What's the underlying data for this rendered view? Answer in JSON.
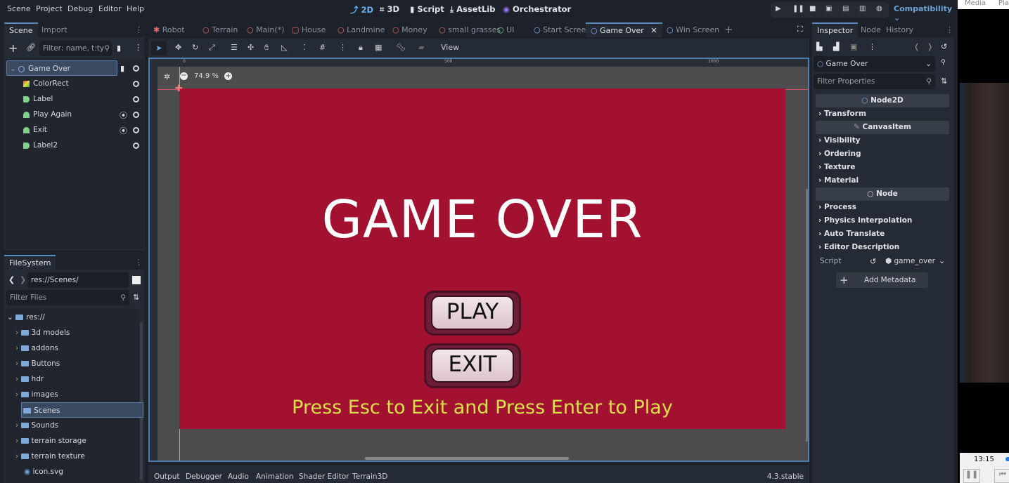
{
  "menu": [
    "Scene",
    "Project",
    "Debug",
    "Editor",
    "Help"
  ],
  "main_screens": [
    "2D",
    "3D",
    "Script",
    "AssetLib",
    "Orchestrator"
  ],
  "renderer": "Compatibility",
  "scene_dock": {
    "tabs": [
      "Scene",
      "Import"
    ],
    "filter_placeholder": "Filter: name, t:ty",
    "nodes": [
      {
        "name": "Game Over",
        "type": "Node2D"
      },
      {
        "name": "ColorRect",
        "type": "ColorRect"
      },
      {
        "name": "Label",
        "type": "Label"
      },
      {
        "name": "Play Again",
        "type": "Button"
      },
      {
        "name": "Exit",
        "type": "Button"
      },
      {
        "name": "Label2",
        "type": "Label"
      }
    ]
  },
  "filesystem": {
    "tab": "FileSystem",
    "path": "res://Scenes/",
    "filter_placeholder": "Filter Files",
    "items": [
      "res://",
      "3d models",
      "addons",
      "Buttons",
      "hdr",
      "images",
      "Scenes",
      "Sounds",
      "terrain storage",
      "terrain texture",
      "icon.svg"
    ]
  },
  "scene_tabs": [
    "Robot",
    "Terrain",
    "Main(*)",
    "House",
    "Landmine",
    "Money",
    "small grasses",
    "UI",
    "Start  Screen",
    "Game Over",
    "Win Screen"
  ],
  "toolbar": {
    "view": "View"
  },
  "viewport": {
    "zoom": "74.9 %",
    "ruler": [
      "0",
      "500",
      "1000"
    ]
  },
  "game": {
    "title": "GAME OVER",
    "play": "PLAY",
    "exit": "EXIT",
    "hint": "Press Esc to Exit and Press Enter to Play",
    "bg": "#a31131",
    "hint_color": "#d7e048"
  },
  "bottom_tabs": [
    "Output",
    "Debugger",
    "Audio",
    "Animation",
    "Shader Editor",
    "Terrain3D"
  ],
  "version": "4.3.stable",
  "inspector": {
    "tabs": [
      "Inspector",
      "Node",
      "History"
    ],
    "object": "Game Over",
    "filter_placeholder": "Filter Properties",
    "sections": [
      {
        "header": "Node2D",
        "items": [
          "Transform"
        ]
      },
      {
        "header": "CanvasItem",
        "items": [
          "Visibility",
          "Ordering",
          "Texture",
          "Material"
        ]
      },
      {
        "header": "Node",
        "items": [
          "Process",
          "Physics Interpolation",
          "Auto Translate",
          "Editor Description"
        ]
      }
    ],
    "script_label": "Script",
    "script_value": "game_over",
    "add_metadata": "Add Metadata"
  },
  "media": {
    "menu": [
      "Media",
      "Pla"
    ],
    "time": "13:15"
  }
}
